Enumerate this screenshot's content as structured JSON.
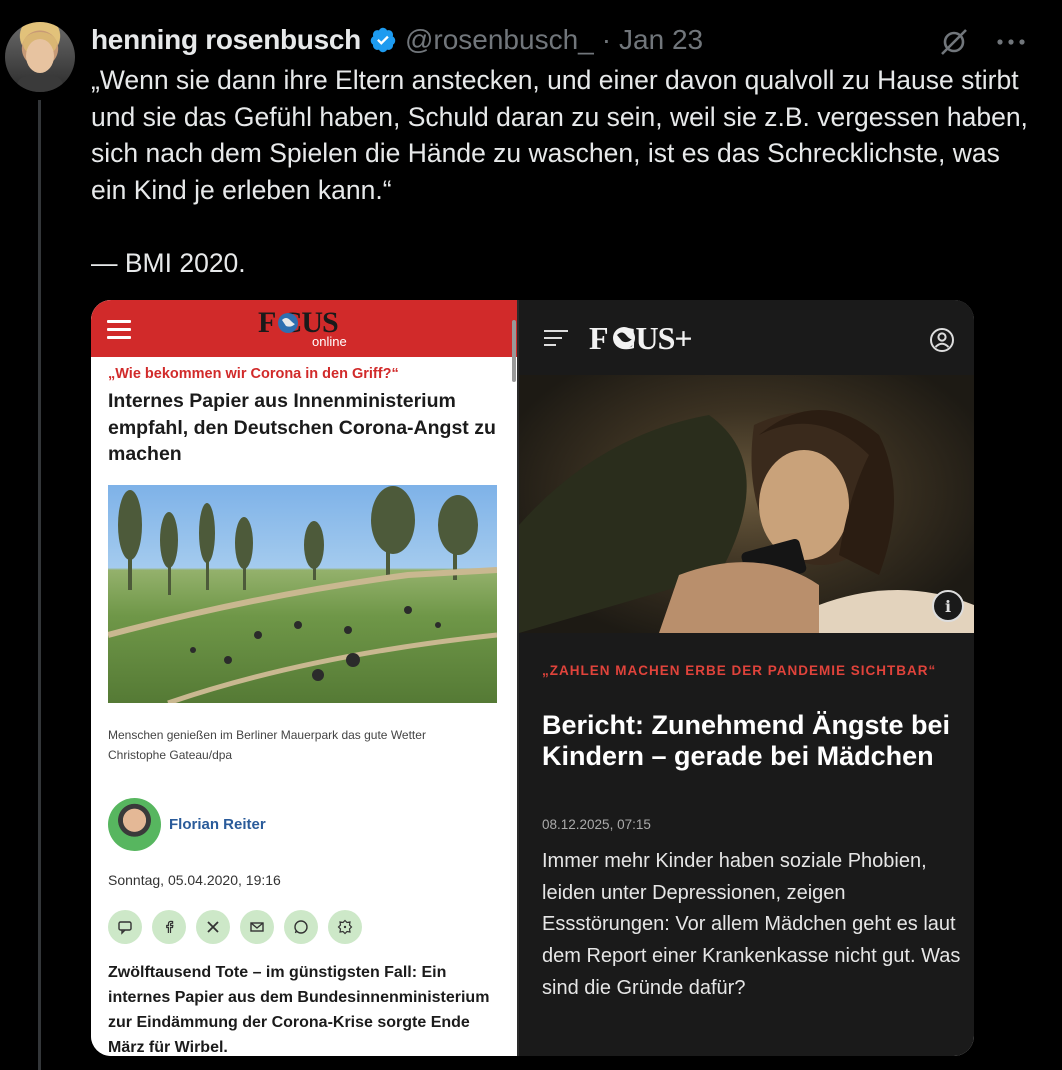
{
  "tweet": {
    "author_name": "henning rosenbusch",
    "handle": "@rosenbusch_",
    "separator": "·",
    "date": "Jan 23",
    "text": "„Wenn sie dann ihre Eltern anstecken, und einer davon qualvoll zu Hause stirbt und sie das Gefühl haben, Schuld daran zu sein, weil sie z.B. vergessen haben, sich nach dem Spielen die Hände zu waschen, ist es das Schrecklichste, was ein Kind je erleben kann.“\n\n— BMI 2020.",
    "verified_color": "#1d9bf0",
    "icons": [
      "grok-icon",
      "more-icon"
    ]
  },
  "left_article": {
    "logo": "F   CUS",
    "logo_sub": "online",
    "kicker": "„Wie bekommen wir Corona in den Griff?“",
    "headline": "Internes Papier aus Innenministerium empfahl, den Deutschen Corona-Angst zu machen",
    "caption_line1": "Menschen genießen im Berliner Mauerpark das gute Wetter",
    "caption_line2": "Christophe Gateau/dpa",
    "author": "Florian Reiter",
    "date": "Sonntag, 05.04.2020, 19:16",
    "share_icons": [
      "comment-icon",
      "facebook-icon",
      "x-icon",
      "mail-icon",
      "whatsapp-icon",
      "more-share-icon"
    ],
    "body": "Zwölftausend Tote – im günstigsten Fall: Ein internes Papier aus dem Bundesinnenministerium zur Eindämmung der Corona-Krise sorgte Ende März für Wirbel.",
    "brand_color": "#d12a2a"
  },
  "right_article": {
    "logo": "F   CUS+",
    "kicker": "„ZAHLEN MACHEN ERBE DER PANDEMIE SICHTBAR“",
    "headline": "Bericht: Zunehmend Ängste bei Kindern – gerade bei Mädchen",
    "date": "08.12.2025, 07:15",
    "body": "Immer mehr Kinder haben soziale Phobien, leiden unter Depressionen, zeigen Essstörungen: Vor allem Mädchen geht es laut dem Report einer Krankenkasse nicht gut. Was sind die Gründe dafür?",
    "info_label": "i",
    "accent_color": "#e0433b"
  }
}
